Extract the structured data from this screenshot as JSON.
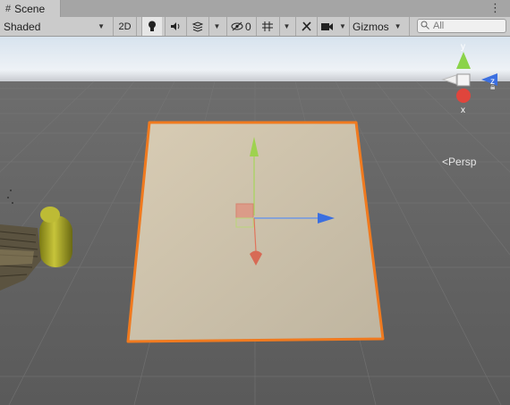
{
  "tab": {
    "icon": "hash-icon",
    "title": "Scene"
  },
  "toolbar": {
    "draw_mode": "Shaded",
    "mode_2d": "2D",
    "hidden_count": "0",
    "gizmos": "Gizmos",
    "search_placeholder": "All"
  },
  "gizmo": {
    "y": "y",
    "z": "z",
    "x": "x",
    "projection": "Persp"
  },
  "colors": {
    "selection_outline": "#f07a1f",
    "plane_fill": "#cbc0aa",
    "sky": "#e7edf4",
    "ground": "#5f5f5f",
    "axis_x": "#e0453c",
    "axis_y": "#8bd34a",
    "axis_z": "#3b6fe0"
  }
}
